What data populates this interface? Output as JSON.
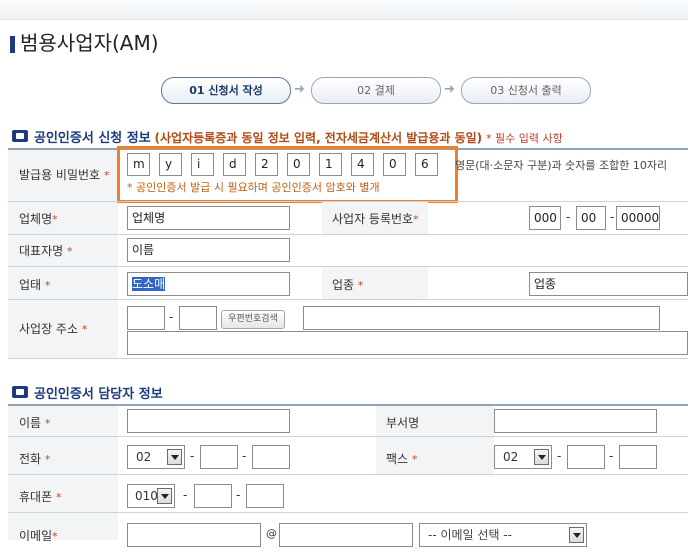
{
  "page": {
    "title": "범용사업자(AM)"
  },
  "steps": [
    {
      "label": "01 신청서 작성",
      "active": true
    },
    {
      "label": "02 결제",
      "active": false
    },
    {
      "label": "03 신청서 출력",
      "active": false
    }
  ],
  "section1": {
    "title": "공인인증서 신청 정보",
    "subtitle": "(사업자등록증과 동일 정보 입력, 전자세금계산서 발급용과 동일)",
    "required_note": "* 필수 입력 사항",
    "password": {
      "label": "발급용 비밀번호",
      "chars": [
        "m",
        "y",
        "i",
        "d",
        "2",
        "0",
        "1",
        "4",
        "0",
        "6"
      ],
      "rule": "영문(대·소문자 구분)과 숫자를 조합한 10자리",
      "hint": "* 공인인증서 발급 시 필요하며 공인인증서 암호와 별개"
    },
    "company": {
      "label": "업체명",
      "value": "업체명"
    },
    "bizno": {
      "label": "사업자 등록번호",
      "part1": "000",
      "part2": "00",
      "part3": "00000"
    },
    "ceo": {
      "label": "대표자명",
      "value": "이름"
    },
    "biztype": {
      "label": "업태",
      "value": "도소매"
    },
    "bizitem": {
      "label": "업종",
      "value": "업종"
    },
    "address": {
      "label": "사업장 주소",
      "zip_button": "우편번호검색",
      "zip1": "",
      "zip2": "",
      "addr1": "",
      "addr2": ""
    }
  },
  "section2": {
    "title": "공인인증서 담당자 정보",
    "name": {
      "label": "이름",
      "value": ""
    },
    "dept": {
      "label": "부서명",
      "value": ""
    },
    "phone": {
      "label": "전화",
      "area": "02"
    },
    "fax": {
      "label": "팩스",
      "area": "02"
    },
    "mobile": {
      "label": "휴대폰",
      "prefix": "010"
    },
    "email": {
      "label": "이메일",
      "at": "@",
      "select": "-- 이메일 선택 --"
    }
  },
  "required_marker": "*",
  "dash": "-",
  "colors": {
    "accent": "#1e3c7b",
    "highlight_border": "#f27e25",
    "required": "#d2401d"
  }
}
